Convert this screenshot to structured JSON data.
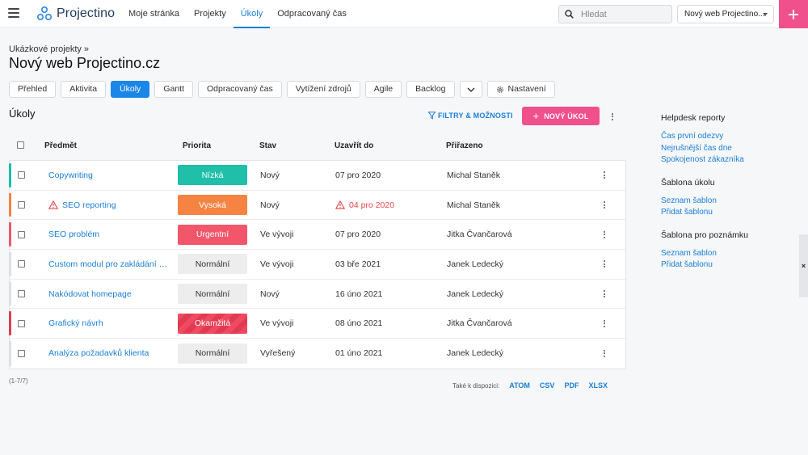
{
  "app": {
    "name": "Projectino"
  },
  "nav": [
    {
      "label": "Moje stránka",
      "active": false
    },
    {
      "label": "Projekty",
      "active": false
    },
    {
      "label": "Úkoly",
      "active": true
    },
    {
      "label": "Odpracovaný čas",
      "active": false
    }
  ],
  "search": {
    "placeholder": "Hledat"
  },
  "project_select": {
    "value": "Nový web Projectino..."
  },
  "breadcrumb": "Ukázkové projekty »",
  "page_title": "Nový web Projectino.cz",
  "project_tabs": [
    {
      "label": "Přehled",
      "active": false
    },
    {
      "label": "Aktivita",
      "active": false
    },
    {
      "label": "Úkoly",
      "active": true
    },
    {
      "label": "Gantt",
      "active": false
    },
    {
      "label": "Odpracovaný čas",
      "active": false
    },
    {
      "label": "Vytížení zdrojů",
      "active": false
    },
    {
      "label": "Agile",
      "active": false
    },
    {
      "label": "Backlog",
      "active": false
    }
  ],
  "settings_tab": "Nastavení",
  "section": {
    "title": "Úkoly",
    "filters_label": "FILTRY & MOŽNOSTI",
    "new_task_label": "NOVÝ ÚKOL"
  },
  "table": {
    "columns": {
      "subject": "Předmět",
      "priority": "Priorita",
      "state": "Stav",
      "due": "Uzavřít do",
      "assignee": "Přiřazeno"
    },
    "rows": [
      {
        "subject": "Copywriting",
        "priority": "Nízká",
        "prio_color": "#1fbfa9",
        "stripe": "#1fbfa9",
        "state": "Nový",
        "due": "07 pro 2020",
        "overdue": false,
        "warning": false,
        "assignee": "Michal Staněk"
      },
      {
        "subject": "SEO reporting",
        "priority": "Vysoká",
        "prio_color": "#f58442",
        "stripe": "#f58442",
        "state": "Nový",
        "due": "04 pro 2020",
        "overdue": true,
        "warning": true,
        "assignee": "Michal Staněk"
      },
      {
        "subject": "SEO problém",
        "priority": "Urgentní",
        "prio_color": "#f2566b",
        "stripe": "#f2566b",
        "state": "Ve vývoji",
        "due": "07 pro 2020",
        "overdue": false,
        "warning": false,
        "assignee": "Jitka Čvančarová"
      },
      {
        "subject": "Custom modul pro zakládání d...",
        "priority": "Normální",
        "prio_color": "#ededed",
        "stripe": "#e0e0e0",
        "state": "Ve vývoji",
        "due": "03 bře 2021",
        "overdue": false,
        "warning": false,
        "assignee": "Janek Ledecký"
      },
      {
        "subject": "Nakódovat homepage",
        "priority": "Normální",
        "prio_color": "#ededed",
        "stripe": "#e0e0e0",
        "state": "Nový",
        "due": "16 úno 2021",
        "overdue": false,
        "warning": false,
        "assignee": "Janek Ledecký"
      },
      {
        "subject": "Grafický návrh",
        "priority": "Okamžitá",
        "prio_color": "#ef4a5f",
        "stripe": "#e23b55",
        "state": "Ve vývoji",
        "due": "08 úno 2021",
        "overdue": false,
        "warning": false,
        "assignee": "Jitka Čvančarová"
      },
      {
        "subject": "Analýza požadavků klienta",
        "priority": "Normální",
        "prio_color": "#ededed",
        "stripe": "#e0e0e0",
        "state": "Vyřešený",
        "due": "01 úno 2021",
        "overdue": false,
        "warning": false,
        "assignee": "Janek Ledecký"
      }
    ]
  },
  "count_label": "(1-7/7)",
  "exports": {
    "label": "Také k dispozici:",
    "formats": [
      "ATOM",
      "CSV",
      "PDF",
      "XLSX"
    ]
  },
  "right_panel": [
    {
      "title": "Helpdesk reporty",
      "links": [
        "Čas první odezvy",
        "Nejrušnější čas dne",
        "Spokojenost zákazníka"
      ]
    },
    {
      "title": "Šablona úkolu",
      "links": [
        "Seznam šablon",
        "Přidat šablonu"
      ]
    },
    {
      "title": "Šablona pro poznámku",
      "links": [
        "Seznam šablon",
        "Přidat šablonu"
      ]
    }
  ],
  "side_tab_label": "×"
}
